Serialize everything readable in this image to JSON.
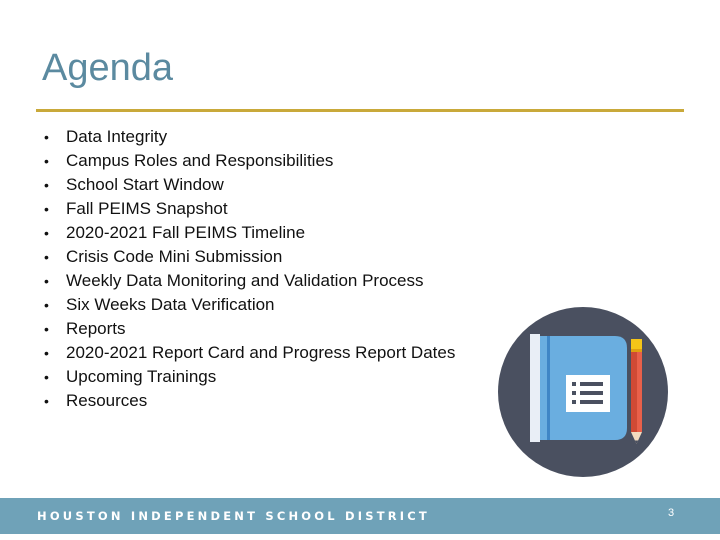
{
  "slide": {
    "title": "Agenda",
    "page_number": "3"
  },
  "agenda": {
    "bullet_glyph": "•",
    "items": [
      {
        "label": "Data Integrity"
      },
      {
        "label": "Campus Roles and Responsibilities"
      },
      {
        "label": "School Start Window"
      },
      {
        "label": "Fall PEIMS Snapshot"
      },
      {
        "label": "2020-2021 Fall PEIMS Timeline"
      },
      {
        "label": "Crisis Code Mini Submission"
      },
      {
        "label": "Weekly Data Monitoring and Validation Process"
      },
      {
        "label": "Six Weeks Data Verification"
      },
      {
        "label": "Reports"
      },
      {
        "label": "2020-2021 Report Card and Progress Report Dates"
      },
      {
        "label": "Upcoming Trainings"
      },
      {
        "label": "Resources"
      }
    ]
  },
  "footer": {
    "organization": "HOUSTON INDEPENDENT SCHOOL DISTRICT"
  },
  "illustration": {
    "icon": "notebook-pencil-icon"
  },
  "colors": {
    "title": "#5b8aa0",
    "rule": "#c9a93a",
    "footer_band": "#6fa2b8",
    "icon_circle": "#4a5060",
    "notebook": "#6aaee0",
    "pencil": "#d04a35"
  }
}
